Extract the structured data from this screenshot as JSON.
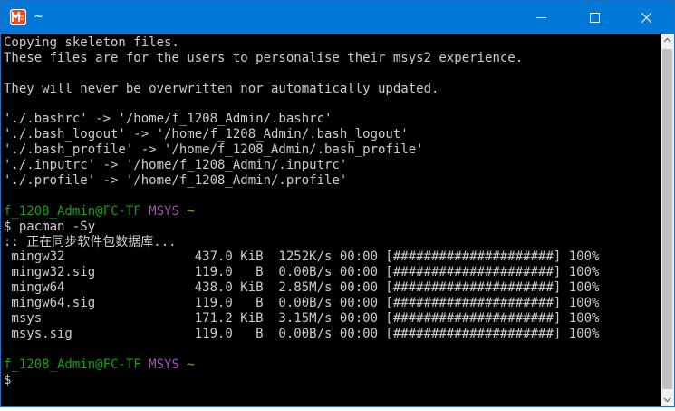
{
  "window": {
    "title": "~",
    "icon": "msys2-icon",
    "controls": [
      "minimize-icon",
      "maximize-icon",
      "close-icon"
    ]
  },
  "colors": {
    "titlebar": "#0078d7",
    "terminal_bg": "#000000",
    "text": "#cccccc",
    "user_host": "#13a10e",
    "msys_label": "#b148c6",
    "path": "#c19c00"
  },
  "terminal": {
    "intro": [
      "Copying skeleton files.",
      "These files are for the users to personalise their msys2 experience.",
      "",
      "They will never be overwritten nor automatically updated.",
      "",
      "'./.bashrc' -> '/home/f_1208_Admin/.bashrc'",
      "'./.bash_logout' -> '/home/f_1208_Admin/.bash_logout'",
      "'./.bash_profile' -> '/home/f_1208_Admin/.bash_profile'",
      "'./.inputrc' -> '/home/f_1208_Admin/.inputrc'",
      "'./.profile' -> '/home/f_1208_Admin/.profile'",
      ""
    ],
    "prompt1": {
      "user_host": "f_1208_Admin@FC-TF",
      "label": "MSYS",
      "path": "~"
    },
    "command1": "$ pacman -Sy",
    "sync_message": ":: 正在同步软件包数据库...",
    "sync_rows": [
      " mingw32                 437.0 KiB  1252K/s 00:00 [#####################] 100%",
      " mingw32.sig             119.0   B  0.00B/s 00:00 [#####################] 100%",
      " mingw64                 438.0 KiB  2.85M/s 00:00 [#####################] 100%",
      " mingw64.sig             119.0   B  0.00B/s 00:00 [#####################] 100%",
      " msys                    171.2 KiB  3.15M/s 00:00 [#####################] 100%",
      " msys.sig                119.0   B  0.00B/s 00:00 [#####################] 100%"
    ],
    "prompt2": {
      "user_host": "f_1208_Admin@FC-TF",
      "label": "MSYS",
      "path": "~"
    },
    "command2": "$"
  }
}
